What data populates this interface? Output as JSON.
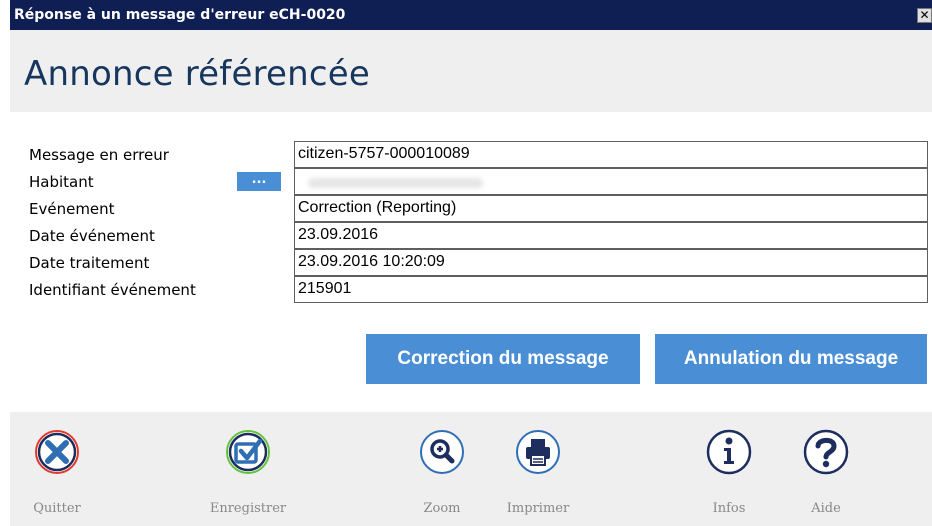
{
  "window": {
    "title": "Réponse à un message d'erreur eCH-0020",
    "close_glyph": "✕"
  },
  "header": {
    "title": "Annonce référencée"
  },
  "form": {
    "rows": [
      {
        "label": "Message en erreur",
        "value": "citizen-5757-000010089"
      },
      {
        "label": "Habitant",
        "value": ""
      },
      {
        "label": "Evénement",
        "value": "Correction (Reporting)"
      },
      {
        "label": "Date événement",
        "value": "23.09.2016"
      },
      {
        "label": "Date traitement",
        "value": "23.09.2016 10:20:09"
      },
      {
        "label": "Identifiant événement",
        "value": "215901"
      }
    ],
    "lookup_button_label": "..."
  },
  "actions": {
    "correction_label": "Correction du message",
    "annulation_label": "Annulation du message"
  },
  "toolbar": {
    "items": [
      {
        "label": "Quitter",
        "icon": "close-icon"
      },
      {
        "label": "Enregistrer",
        "icon": "check-icon"
      },
      {
        "label": "Zoom",
        "icon": "zoom-icon"
      },
      {
        "label": "Imprimer",
        "icon": "printer-icon"
      },
      {
        "label": "Infos",
        "icon": "info-icon"
      },
      {
        "label": "Aide",
        "icon": "help-icon"
      }
    ]
  },
  "colors": {
    "titlebar": "#0f1f54",
    "accent_button": "#4a8ed6",
    "heading_text": "#17365d",
    "quit_red": "#e0392f",
    "save_green": "#63c23c",
    "icon_blue": "#2f6db5",
    "icon_navy": "#1c2d5e"
  }
}
